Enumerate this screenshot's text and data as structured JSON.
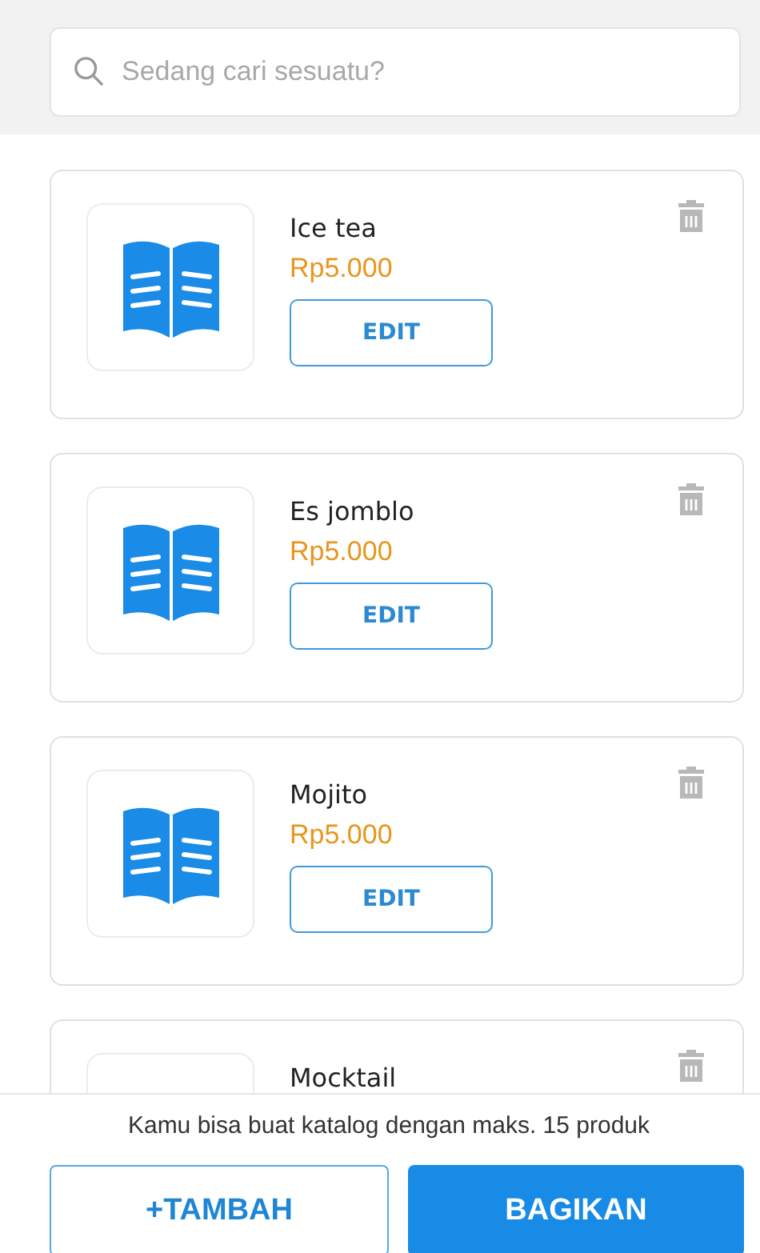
{
  "search": {
    "placeholder": "Sedang cari sesuatu?"
  },
  "products": [
    {
      "name": "Ice tea",
      "price": "Rp5.000",
      "action": "EDIT"
    },
    {
      "name": "Es jomblo",
      "price": "Rp5.000",
      "action": "EDIT"
    },
    {
      "name": "Mojito",
      "price": "Rp5.000",
      "action": "EDIT"
    },
    {
      "name": "Mocktail"
    }
  ],
  "footer": {
    "note": "Kamu bisa buat katalog dengan maks. 15 produk",
    "buttons": [
      "+TAMBAH",
      "BAGIKAN"
    ]
  }
}
